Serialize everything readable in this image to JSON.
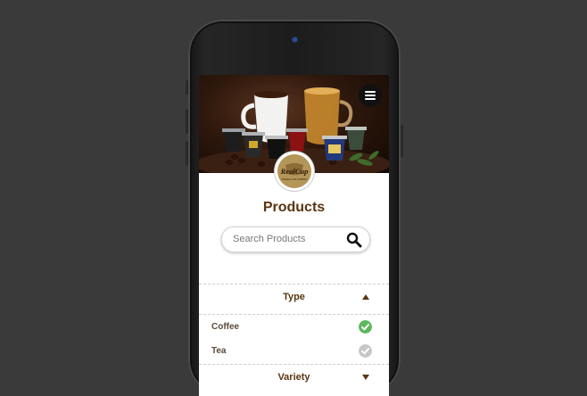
{
  "header": {
    "menu_icon": "hamburger-menu-icon"
  },
  "brand": {
    "logo_text": "RealCup",
    "logo_subtext": "COFFEE & TEA COMPANY"
  },
  "page": {
    "title": "Products"
  },
  "search": {
    "placeholder": "Search Products",
    "icon": "search-icon"
  },
  "filters": {
    "type": {
      "label": "Type",
      "expanded": true,
      "options": [
        {
          "label": "Coffee",
          "checked": true
        },
        {
          "label": "Tea",
          "checked": false
        }
      ]
    },
    "variety": {
      "label": "Variety",
      "expanded": false
    }
  },
  "colors": {
    "brand_brown": "#5a3512",
    "check_on": "#5cb85c",
    "check_off": "#c7c7c7",
    "background": "#3a3a3a"
  }
}
